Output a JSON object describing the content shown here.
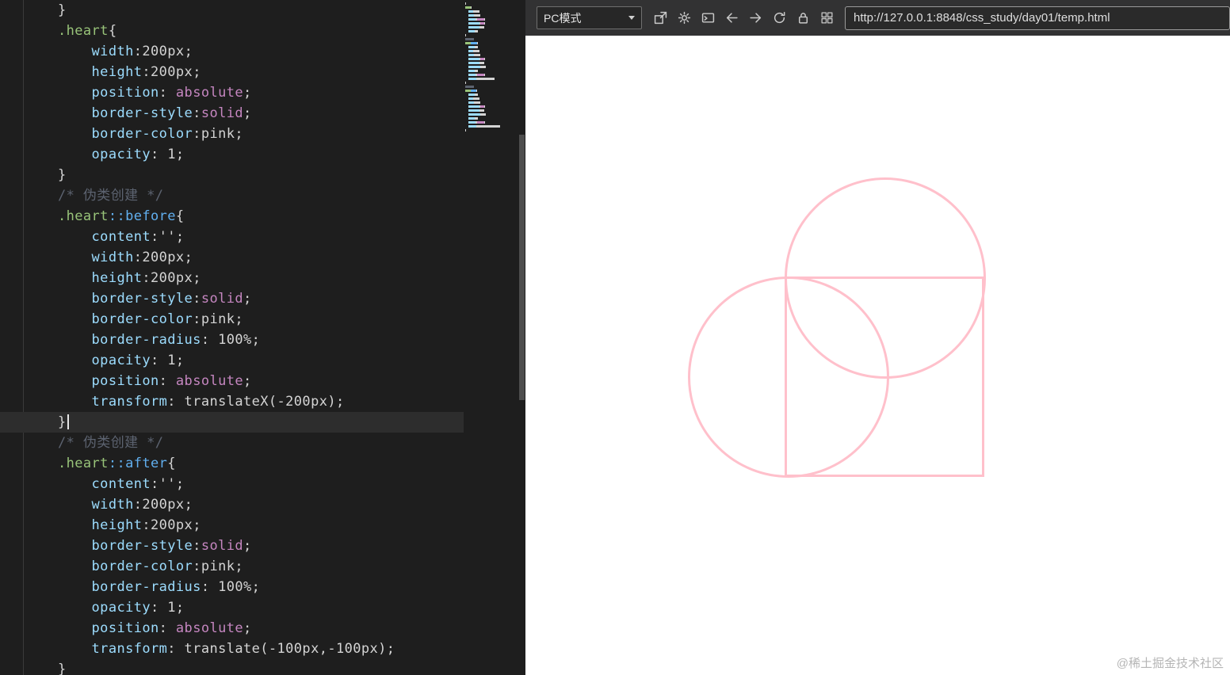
{
  "palette": {
    "editor_bg": "#1e1e1e",
    "current_line_bg": "#2d2d2d",
    "toolbar_bg": "#323233",
    "punct": "#d4d4d4",
    "selector": "#98c379",
    "pseudo": "#61afef",
    "prop": "#9cdcfe",
    "keyword": "#c586c0",
    "value": "#d4d4d4",
    "comment": "#5c6370",
    "pink": "#ffc0cb",
    "watermark": "#b5b5b5"
  },
  "editor": {
    "current_line_index": 20,
    "lines": [
      {
        "tokens": [
          [
            "punct",
            "}"
          ]
        ]
      },
      {
        "tokens": [
          [
            "selector",
            ".heart"
          ],
          [
            "punct",
            "{"
          ]
        ]
      },
      {
        "tokens": [
          [
            "punct",
            "    "
          ],
          [
            "prop",
            "width"
          ],
          [
            "punct",
            ":"
          ],
          [
            "value",
            "200px"
          ],
          [
            "punct",
            ";"
          ]
        ]
      },
      {
        "tokens": [
          [
            "punct",
            "    "
          ],
          [
            "prop",
            "height"
          ],
          [
            "punct",
            ":"
          ],
          [
            "value",
            "200px"
          ],
          [
            "punct",
            ";"
          ]
        ]
      },
      {
        "tokens": [
          [
            "punct",
            "    "
          ],
          [
            "prop",
            "position"
          ],
          [
            "punct",
            ": "
          ],
          [
            "keyword",
            "absolute"
          ],
          [
            "punct",
            ";"
          ]
        ]
      },
      {
        "tokens": [
          [
            "punct",
            "    "
          ],
          [
            "prop",
            "border-style"
          ],
          [
            "punct",
            ":"
          ],
          [
            "keyword",
            "solid"
          ],
          [
            "punct",
            ";"
          ]
        ]
      },
      {
        "tokens": [
          [
            "punct",
            "    "
          ],
          [
            "prop",
            "border-color"
          ],
          [
            "punct",
            ":"
          ],
          [
            "value",
            "pink"
          ],
          [
            "punct",
            ";"
          ]
        ]
      },
      {
        "tokens": [
          [
            "punct",
            "    "
          ],
          [
            "prop",
            "opacity"
          ],
          [
            "punct",
            ": "
          ],
          [
            "value",
            "1"
          ],
          [
            "punct",
            ";"
          ]
        ]
      },
      {
        "tokens": [
          [
            "punct",
            "}"
          ]
        ]
      },
      {
        "tokens": [
          [
            "comment",
            "/* 伪类创建 */"
          ]
        ]
      },
      {
        "tokens": [
          [
            "selector",
            ".heart"
          ],
          [
            "pseudo",
            "::before"
          ],
          [
            "punct",
            "{"
          ]
        ]
      },
      {
        "tokens": [
          [
            "punct",
            "    "
          ],
          [
            "prop",
            "content"
          ],
          [
            "punct",
            ":"
          ],
          [
            "value",
            "''"
          ],
          [
            "punct",
            ";"
          ]
        ]
      },
      {
        "tokens": [
          [
            "punct",
            "    "
          ],
          [
            "prop",
            "width"
          ],
          [
            "punct",
            ":"
          ],
          [
            "value",
            "200px"
          ],
          [
            "punct",
            ";"
          ]
        ]
      },
      {
        "tokens": [
          [
            "punct",
            "    "
          ],
          [
            "prop",
            "height"
          ],
          [
            "punct",
            ":"
          ],
          [
            "value",
            "200px"
          ],
          [
            "punct",
            ";"
          ]
        ]
      },
      {
        "tokens": [
          [
            "punct",
            "    "
          ],
          [
            "prop",
            "border-style"
          ],
          [
            "punct",
            ":"
          ],
          [
            "keyword",
            "solid"
          ],
          [
            "punct",
            ";"
          ]
        ]
      },
      {
        "tokens": [
          [
            "punct",
            "    "
          ],
          [
            "prop",
            "border-color"
          ],
          [
            "punct",
            ":"
          ],
          [
            "value",
            "pink"
          ],
          [
            "punct",
            ";"
          ]
        ]
      },
      {
        "tokens": [
          [
            "punct",
            "    "
          ],
          [
            "prop",
            "border-radius"
          ],
          [
            "punct",
            ": "
          ],
          [
            "value",
            "100%"
          ],
          [
            "punct",
            ";"
          ]
        ]
      },
      {
        "tokens": [
          [
            "punct",
            "    "
          ],
          [
            "prop",
            "opacity"
          ],
          [
            "punct",
            ": "
          ],
          [
            "value",
            "1"
          ],
          [
            "punct",
            ";"
          ]
        ]
      },
      {
        "tokens": [
          [
            "punct",
            "    "
          ],
          [
            "prop",
            "position"
          ],
          [
            "punct",
            ": "
          ],
          [
            "keyword",
            "absolute"
          ],
          [
            "punct",
            ";"
          ]
        ]
      },
      {
        "tokens": [
          [
            "punct",
            "    "
          ],
          [
            "prop",
            "transform"
          ],
          [
            "punct",
            ": "
          ],
          [
            "value",
            "translateX(-200px)"
          ],
          [
            "punct",
            ";"
          ]
        ]
      },
      {
        "tokens": [
          [
            "punct",
            "}"
          ]
        ]
      },
      {
        "tokens": [
          [
            "comment",
            "/* 伪类创建 */"
          ]
        ]
      },
      {
        "tokens": [
          [
            "selector",
            ".heart"
          ],
          [
            "pseudo",
            "::after"
          ],
          [
            "punct",
            "{"
          ]
        ]
      },
      {
        "tokens": [
          [
            "punct",
            "    "
          ],
          [
            "prop",
            "content"
          ],
          [
            "punct",
            ":"
          ],
          [
            "value",
            "''"
          ],
          [
            "punct",
            ";"
          ]
        ]
      },
      {
        "tokens": [
          [
            "punct",
            "    "
          ],
          [
            "prop",
            "width"
          ],
          [
            "punct",
            ":"
          ],
          [
            "value",
            "200px"
          ],
          [
            "punct",
            ";"
          ]
        ]
      },
      {
        "tokens": [
          [
            "punct",
            "    "
          ],
          [
            "prop",
            "height"
          ],
          [
            "punct",
            ":"
          ],
          [
            "value",
            "200px"
          ],
          [
            "punct",
            ";"
          ]
        ]
      },
      {
        "tokens": [
          [
            "punct",
            "    "
          ],
          [
            "prop",
            "border-style"
          ],
          [
            "punct",
            ":"
          ],
          [
            "keyword",
            "solid"
          ],
          [
            "punct",
            ";"
          ]
        ]
      },
      {
        "tokens": [
          [
            "punct",
            "    "
          ],
          [
            "prop",
            "border-color"
          ],
          [
            "punct",
            ":"
          ],
          [
            "value",
            "pink"
          ],
          [
            "punct",
            ";"
          ]
        ]
      },
      {
        "tokens": [
          [
            "punct",
            "    "
          ],
          [
            "prop",
            "border-radius"
          ],
          [
            "punct",
            ": "
          ],
          [
            "value",
            "100%"
          ],
          [
            "punct",
            ";"
          ]
        ]
      },
      {
        "tokens": [
          [
            "punct",
            "    "
          ],
          [
            "prop",
            "opacity"
          ],
          [
            "punct",
            ": "
          ],
          [
            "value",
            "1"
          ],
          [
            "punct",
            ";"
          ]
        ]
      },
      {
        "tokens": [
          [
            "punct",
            "    "
          ],
          [
            "prop",
            "position"
          ],
          [
            "punct",
            ": "
          ],
          [
            "keyword",
            "absolute"
          ],
          [
            "punct",
            ";"
          ]
        ]
      },
      {
        "tokens": [
          [
            "punct",
            "    "
          ],
          [
            "prop",
            "transform"
          ],
          [
            "punct",
            ": "
          ],
          [
            "value",
            "translate(-100px,-100px)"
          ],
          [
            "punct",
            ";"
          ]
        ]
      },
      {
        "tokens": [
          [
            "punct",
            "}"
          ]
        ]
      }
    ]
  },
  "browser": {
    "toolbar": {
      "mode_select": {
        "value": "PC模式"
      },
      "icons": [
        "popout-icon",
        "gear-icon",
        "console-icon",
        "back-icon",
        "forward-icon",
        "refresh-icon",
        "lock-icon",
        "grid-icon"
      ],
      "url": "http://127.0.0.1:8848/css_study/day01/temp.html"
    },
    "watermark": "@稀土掘金技术社区"
  }
}
